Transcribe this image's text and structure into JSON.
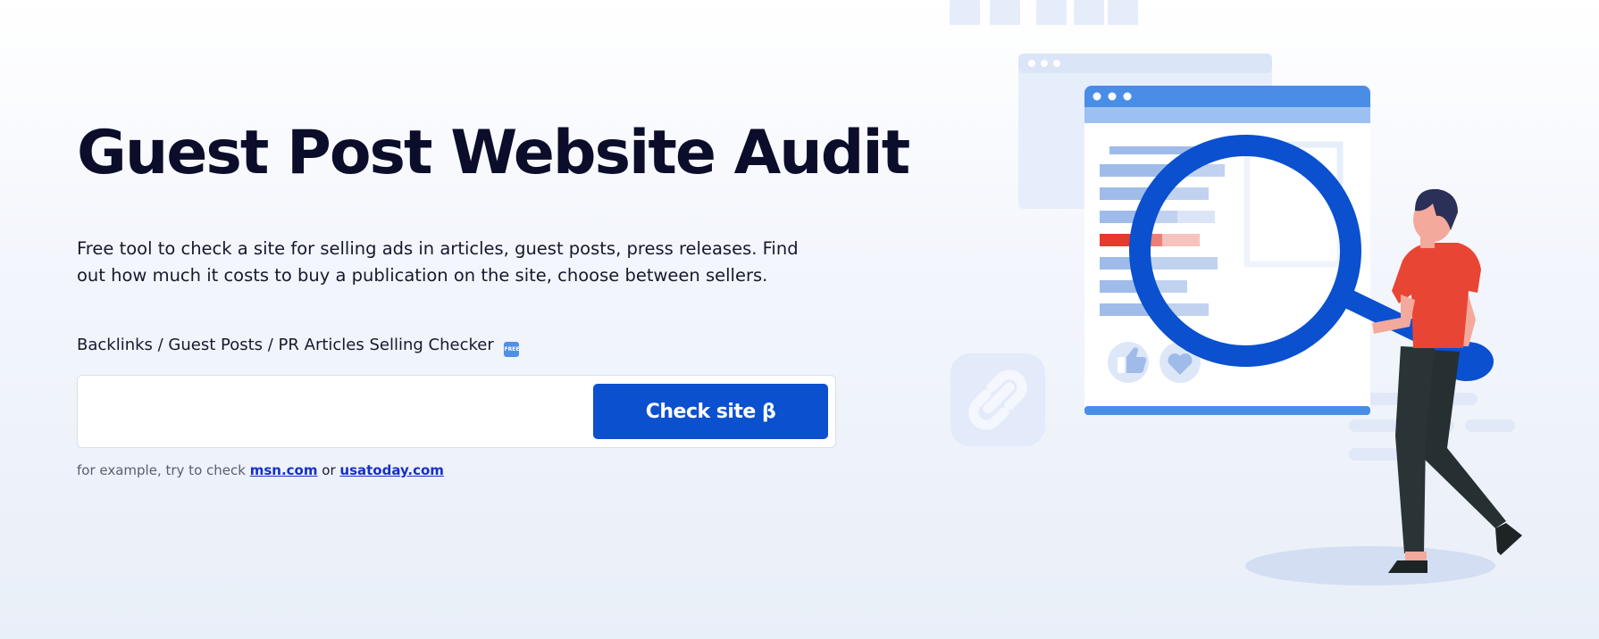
{
  "hero": {
    "title": "Guest Post Website Audit",
    "description": "Free tool to check a site for selling ads in articles, guest posts, press releases. Find out how much it costs to buy a publication on the site, choose between sellers.",
    "checker_label": "Backlinks / Guest Posts / PR Articles Selling Checker",
    "free_badge": "FREE",
    "search": {
      "value": "",
      "placeholder": ""
    },
    "check_button": "Check site β",
    "example": {
      "prefix": "for example, try to check",
      "link1": "msn.com",
      "or_text": "or",
      "link2": "usatoday.com"
    }
  },
  "illustration": {
    "icons": [
      "link-icon",
      "thumbs-up-icon",
      "heart-icon",
      "magnifying-glass-icon"
    ]
  },
  "colors": {
    "accent": "#0a50cf",
    "title": "#0b0d2b",
    "link": "#1530c9",
    "shirt": "#e94535",
    "highlight_bar": "#e8392e"
  }
}
